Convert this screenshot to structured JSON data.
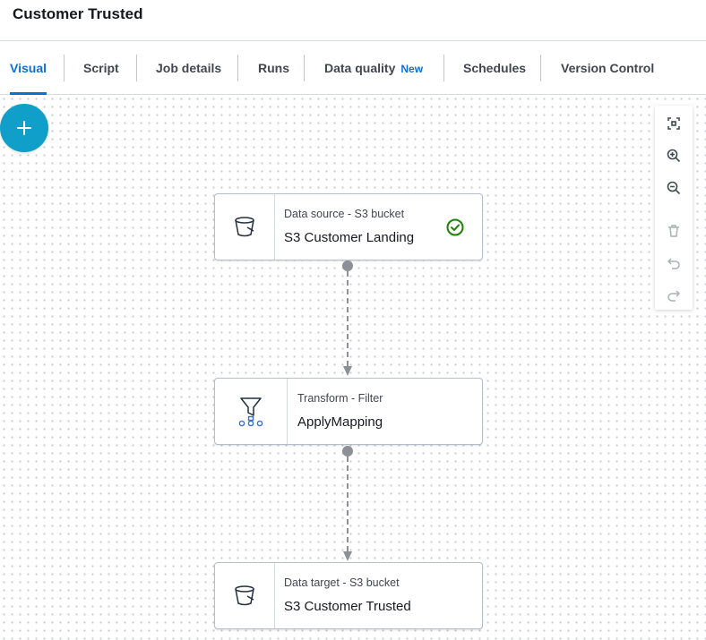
{
  "header": {
    "title": "Customer Trusted"
  },
  "tabs": [
    {
      "label": "Visual"
    },
    {
      "label": "Script"
    },
    {
      "label": "Job details"
    },
    {
      "label": "Runs"
    },
    {
      "label": "Data quality",
      "badge": "New"
    },
    {
      "label": "Schedules"
    },
    {
      "label": "Version Control"
    }
  ],
  "canvas": {
    "add_button_icon": "plus-icon",
    "toolbar": [
      "fit-view-icon",
      "zoom-in-icon",
      "zoom-out-icon",
      "trash-icon",
      "undo-icon",
      "redo-icon"
    ],
    "nodes": [
      {
        "type": "Data source - S3 bucket",
        "name": "S3 Customer Landing",
        "icon": "s3-bucket-icon",
        "status": "success-check-icon"
      },
      {
        "type": "Transform - Filter",
        "name": "ApplyMapping",
        "icon": "filter-icon"
      },
      {
        "type": "Data target - S3 bucket",
        "name": "S3 Customer Trusted",
        "icon": "s3-bucket-icon"
      }
    ]
  },
  "colors": {
    "accent": "#0972d3",
    "add_button": "#0f9fc8",
    "success": "#1d8102",
    "connector": "#8d9096"
  }
}
